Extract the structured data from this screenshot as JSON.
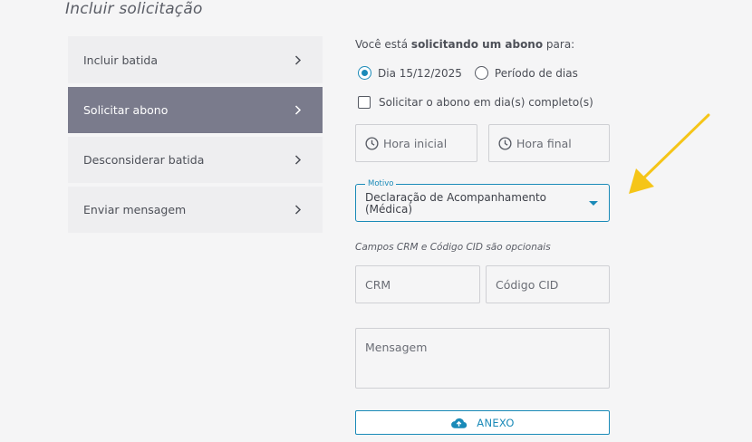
{
  "page": {
    "title": "Incluir solicitação"
  },
  "menu": {
    "items": [
      {
        "label": "Incluir batida",
        "active": false
      },
      {
        "label": "Solicitar abono",
        "active": true
      },
      {
        "label": "Desconsiderar batida",
        "active": false
      },
      {
        "label": "Enviar mensagem",
        "active": false
      }
    ]
  },
  "form": {
    "intro_prefix": "Você está ",
    "intro_bold": "solicitando um abono",
    "intro_suffix": " para:",
    "radio_day": {
      "label": "Dia 15/12/2025",
      "checked": true
    },
    "radio_period": {
      "label": "Período de dias",
      "checked": false
    },
    "full_day_checkbox": {
      "label": "Solicitar o abono em dia(s) completo(s)",
      "checked": false
    },
    "hora_inicial": {
      "placeholder": "Hora inicial"
    },
    "hora_final": {
      "placeholder": "Hora final"
    },
    "motivo": {
      "label": "Motivo",
      "value": "Declaração de Acompanhamento (Médica)"
    },
    "optional_note": "Campos CRM e Código CID são opcionais",
    "crm": {
      "placeholder": "CRM"
    },
    "cid": {
      "placeholder": "Código CID"
    },
    "mensagem": {
      "placeholder": "Mensagem"
    },
    "anexo_button": {
      "label": "ANEXO"
    }
  },
  "colors": {
    "accent": "#1a8ab8",
    "menu_active_bg": "#7a7b8c",
    "annotation_arrow": "#f5c518"
  },
  "icons": {
    "menu_chevron": "chevron-right-icon",
    "time": "clock-icon",
    "dropdown": "caret-down-icon",
    "upload": "cloud-upload-icon",
    "annotation": "arrow-annotation-icon"
  }
}
